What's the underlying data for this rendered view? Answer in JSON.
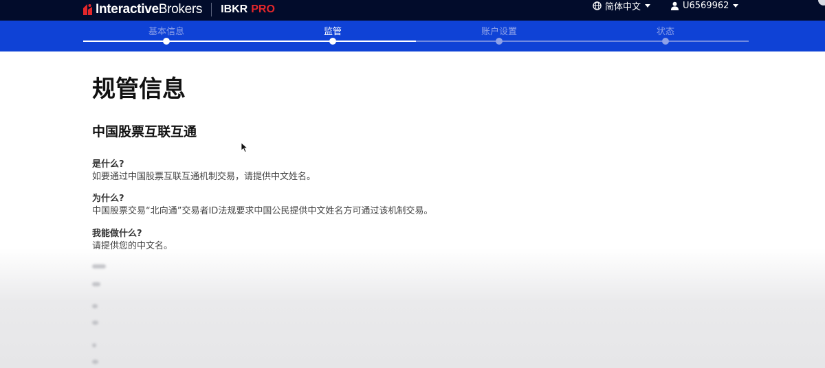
{
  "brand": {
    "name_bold": "Interactive",
    "name_light": "Brokers",
    "product": "IBKR",
    "product_accent": "PRO",
    "accent_color": "#e3272b"
  },
  "header": {
    "language": "简体中文",
    "account_id": "U6569962",
    "language_icon": "globe-icon",
    "user_icon": "user-icon"
  },
  "stepper": {
    "steps": [
      {
        "label": "基本信息",
        "state": "done"
      },
      {
        "label": "监管",
        "state": "active"
      },
      {
        "label": "账户设置",
        "state": "pending"
      },
      {
        "label": "状态",
        "state": "pending"
      }
    ],
    "bar_color": "#0f42d6"
  },
  "main": {
    "title": "规管信息",
    "section_title": "中国股票互联互通",
    "qa": [
      {
        "q": "是什么?",
        "a": "如要通过中国股票互联互通机制交易，请提供中文姓名。"
      },
      {
        "q": "为什么?",
        "a": "中国股票交易“北向通”交易者ID法规要求中国公民提供中文姓名方可通过该机制交易。"
      },
      {
        "q": "我能做什么?",
        "a": "请提供您的中文名。"
      }
    ]
  }
}
